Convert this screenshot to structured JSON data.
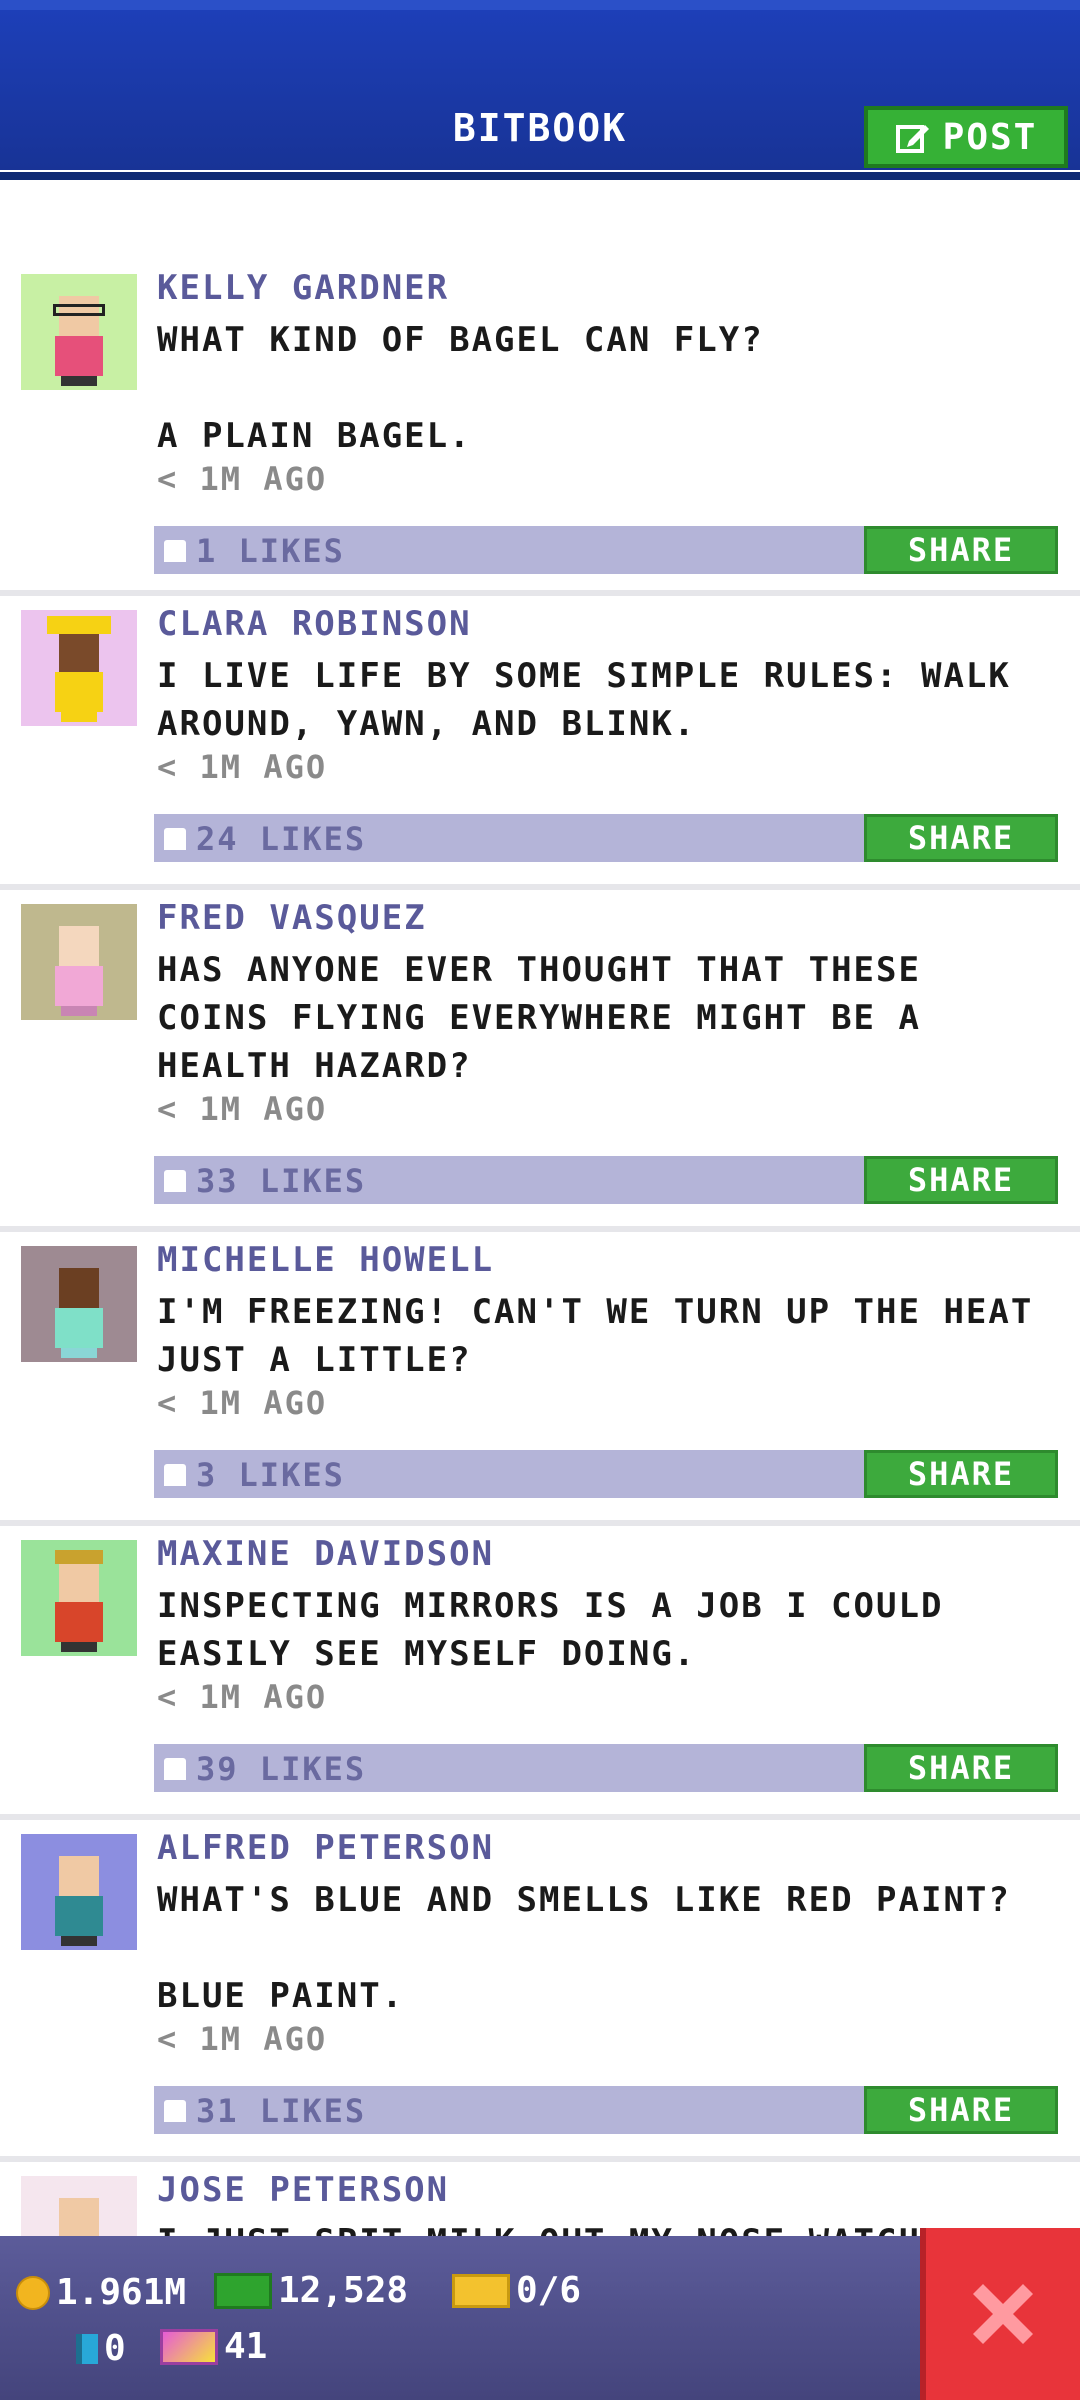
{
  "header": {
    "title": "BITBOOK",
    "post_label": "POST"
  },
  "feed": [
    {
      "name": "KELLY GARDNER",
      "message": "WHAT KIND OF BAGEL CAN FLY?\n\nA PLAIN BAGEL.",
      "time": "< 1M AGO",
      "likes": "1 LIKES",
      "avatar_bg": "#c8f0a4"
    },
    {
      "name": "CLARA ROBINSON",
      "message": "I LIVE LIFE BY SOME SIMPLE RULES: WALK\nAROUND, YAWN, AND BLINK.",
      "time": "< 1M AGO",
      "likes": "24 LIKES",
      "avatar_bg": "#ecc4ee"
    },
    {
      "name": "FRED VASQUEZ",
      "message": "HAS ANYONE EVER THOUGHT THAT THESE\nCOINS FLYING EVERYWHERE MIGHT BE A\nHEALTH HAZARD?",
      "time": "< 1M AGO",
      "likes": "33 LIKES",
      "avatar_bg": "#bfb88e"
    },
    {
      "name": "MICHELLE HOWELL",
      "message": "I'M FREEZING! CAN'T WE TURN UP THE HEAT\nJUST A LITTLE?",
      "time": "< 1M AGO",
      "likes": "3 LIKES",
      "avatar_bg": "#9e8a92"
    },
    {
      "name": "MAXINE DAVIDSON",
      "message": "INSPECTING MIRRORS IS A JOB I COULD\nEASILY SEE MYSELF DOING.",
      "time": "< 1M AGO",
      "likes": "39 LIKES",
      "avatar_bg": "#9ae39a"
    },
    {
      "name": "ALFRED PETERSON",
      "message": "WHAT'S BLUE AND SMELLS LIKE RED PAINT?\n\nBLUE PAINT.",
      "time": "< 1M AGO",
      "likes": "31 LIKES",
      "avatar_bg": "#8c8ee0"
    },
    {
      "name": "JOSE PETERSON",
      "message": "I JUST SPIT MILK OUT MY NOSE WATCHI",
      "time": "",
      "likes": "",
      "avatar_bg": "#f5e6ee"
    }
  ],
  "share_label": "SHARE",
  "bottom_bar": {
    "coins": "1.961M",
    "bux": "12,528",
    "tickets": "0/6",
    "cubes": "0",
    "vip": "41"
  },
  "colors": {
    "header_blue": "#1d3fb8",
    "post_green": "#36b136",
    "likes_bar": "#b4b4d8",
    "close_red": "#e8343a"
  }
}
